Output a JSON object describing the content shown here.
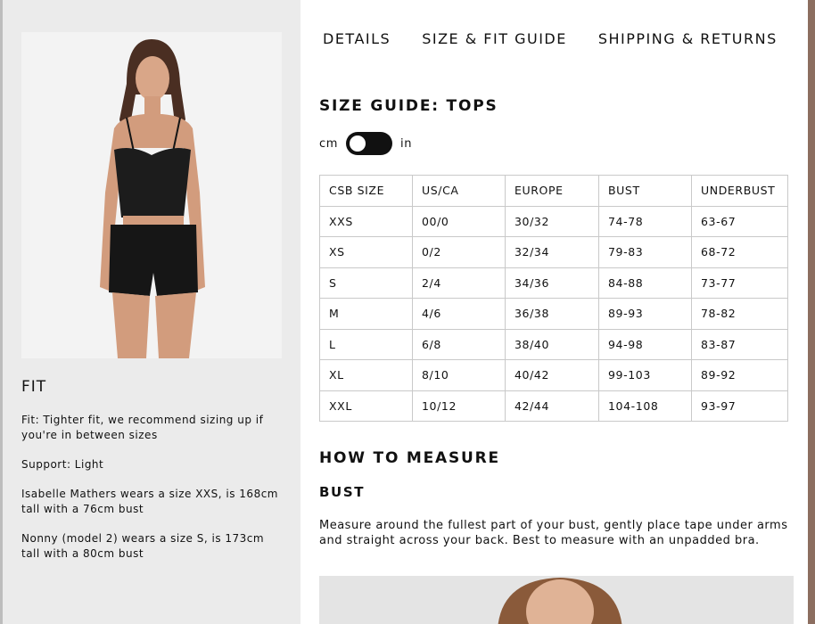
{
  "tabs": [
    {
      "label": "DETAILS"
    },
    {
      "label": "SIZE & FIT GUIDE"
    },
    {
      "label": "SHIPPING & RETURNS"
    }
  ],
  "size_guide": {
    "title": "SIZE GUIDE: TOPS",
    "unit_left": "cm",
    "unit_right": "in",
    "selected_unit": "cm",
    "columns": [
      "CSB SIZE",
      "US/CA",
      "EUROPE",
      "BUST",
      "UNDERBUST"
    ],
    "rows": [
      [
        "XXS",
        "00/0",
        "30/32",
        "74-78",
        "63-67"
      ],
      [
        "XS",
        "0/2",
        "32/34",
        "79-83",
        "68-72"
      ],
      [
        "S",
        "2/4",
        "34/36",
        "84-88",
        "73-77"
      ],
      [
        "M",
        "4/6",
        "36/38",
        "89-93",
        "78-82"
      ],
      [
        "L",
        "6/8",
        "38/40",
        "94-98",
        "83-87"
      ],
      [
        "XL",
        "8/10",
        "40/42",
        "99-103",
        "89-92"
      ],
      [
        "XXL",
        "10/12",
        "42/44",
        "104-108",
        "93-97"
      ]
    ]
  },
  "fit": {
    "heading": "FIT",
    "notes": [
      "Fit: Tighter fit, we recommend sizing up if you're in between sizes",
      "Support: Light",
      "Isabelle Mathers wears a size XXS, is 168cm tall with a 76cm bust",
      "Nonny (model 2) wears a size S, is 173cm tall with a 80cm bust"
    ]
  },
  "how_to_measure": {
    "title": "HOW TO MEASURE",
    "bust_title": "BUST",
    "bust_text": "Measure around the fullest part of your bust, gently place tape under arms and straight across your back. Best to measure with an unpadded bra."
  },
  "colors": {
    "panel_bg": "#ebebeb",
    "content_bg": "#ffffff",
    "toggle": "#111111",
    "table_border": "#c9c9c9"
  }
}
